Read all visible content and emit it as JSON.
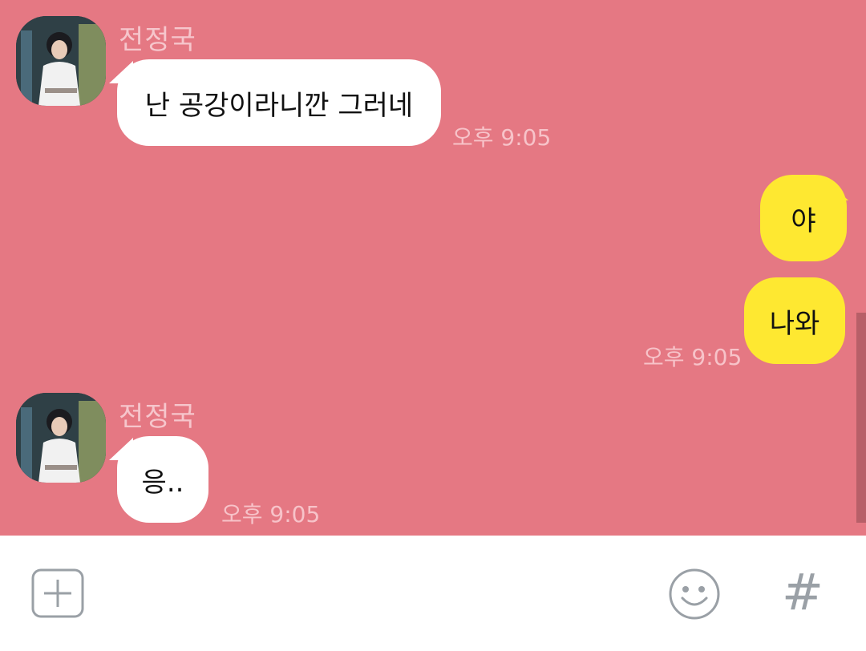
{
  "theme": {
    "background": "#e57883",
    "incoming_bubble": "#ffffff",
    "outgoing_bubble": "#fee831",
    "sender_name_color": "#f6c6cc",
    "timestamp_color": "#f7c3c9",
    "input_bar_background": "#ffffff",
    "icon_color": "#9aa0a6"
  },
  "messages": [
    {
      "sender": "전정국",
      "text": "난 공강이라니깐 그러네",
      "time": "오후 9:05",
      "direction": "incoming"
    },
    {
      "text": "야",
      "direction": "outgoing"
    },
    {
      "text": "나와",
      "time": "오후 9:05",
      "direction": "outgoing"
    },
    {
      "sender": "전정국",
      "text": "응..",
      "time": "오후 9:05",
      "direction": "incoming"
    }
  ],
  "input_bar": {
    "attach_icon": "plus-square-icon",
    "emoji_icon": "smiley-icon",
    "hashtag_label": "#"
  }
}
